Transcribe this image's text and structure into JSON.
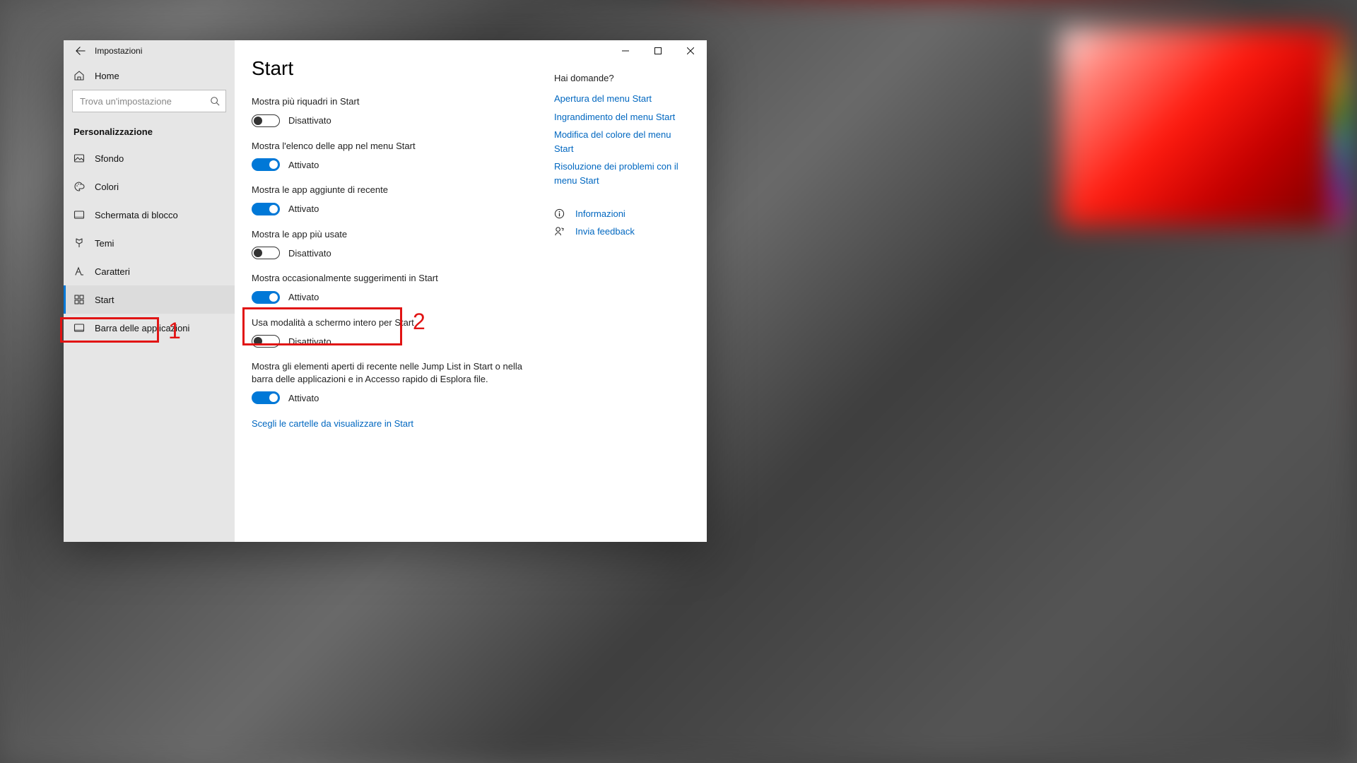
{
  "app": {
    "title": "Impostazioni",
    "back_aria": "Indietro"
  },
  "sidebar": {
    "home": "Home",
    "search_placeholder": "Trova un'impostazione",
    "section": "Personalizzazione",
    "items": [
      {
        "label": "Sfondo"
      },
      {
        "label": "Colori"
      },
      {
        "label": "Schermata di blocco"
      },
      {
        "label": "Temi"
      },
      {
        "label": "Caratteri"
      },
      {
        "label": "Start"
      },
      {
        "label": "Barra delle applicazioni"
      }
    ]
  },
  "page": {
    "title": "Start",
    "settings": [
      {
        "label": "Mostra più riquadri in Start",
        "on": false,
        "state": "Disattivato"
      },
      {
        "label": "Mostra l'elenco delle app nel menu Start",
        "on": true,
        "state": "Attivato"
      },
      {
        "label": "Mostra le app aggiunte di recente",
        "on": true,
        "state": "Attivato"
      },
      {
        "label": "Mostra le app più usate",
        "on": false,
        "state": "Disattivato"
      },
      {
        "label": "Mostra occasionalmente suggerimenti in Start",
        "on": true,
        "state": "Attivato"
      },
      {
        "label": "Usa modalità a schermo intero per Start",
        "on": false,
        "state": "Disattivato"
      },
      {
        "label": "Mostra gli elementi aperti di recente nelle Jump List in Start o nella barra delle applicazioni e in Accesso rapido di Esplora file.",
        "on": true,
        "state": "Attivato"
      }
    ],
    "folders_link": "Scegli le cartelle da visualizzare in Start"
  },
  "aside": {
    "help_title": "Hai domande?",
    "links": [
      "Apertura del menu Start",
      "Ingrandimento del menu Start",
      "Modifica del colore del menu Start",
      "Risoluzione dei problemi con il menu Start"
    ],
    "info": "Informazioni",
    "feedback": "Invia feedback"
  },
  "annotations": {
    "n1": "1",
    "n2": "2"
  }
}
